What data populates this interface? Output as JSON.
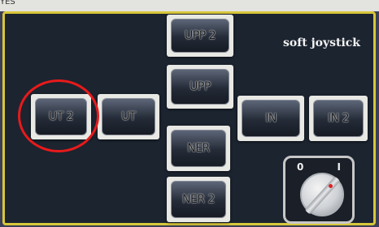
{
  "frame": {
    "label": "YES"
  },
  "panel": {
    "title": "soft joystick"
  },
  "buttons": {
    "upp2": "UPP 2",
    "upp": "UPP",
    "ut2": "UT 2",
    "ut": "UT",
    "in": "IN",
    "in2": "IN 2",
    "ner": "NER",
    "ner2": "NER 2"
  },
  "switch": {
    "off_label": "0",
    "on_label": "I",
    "position": "on"
  },
  "colors": {
    "panel_bg": "#1c2430",
    "panel_border": "#d8c73a",
    "highlight": "#e81a1a"
  },
  "highlight_target": "ut2-button"
}
